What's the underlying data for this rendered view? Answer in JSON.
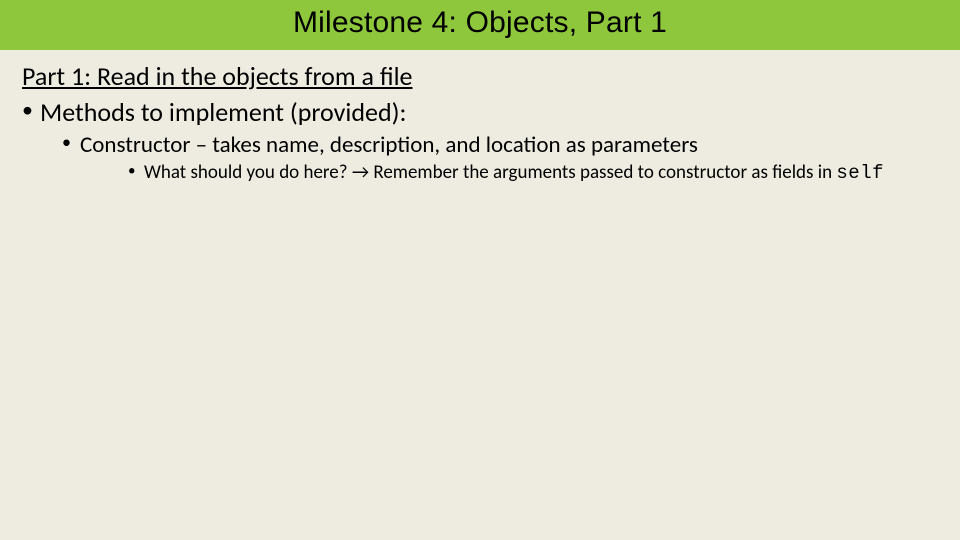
{
  "title": "Milestone 4: Objects, Part 1",
  "heading": "Part 1: Read in the objects from a file",
  "bullets": {
    "lvl1": "Methods to implement (provided):",
    "lvl2": "Constructor – takes name, description, and location as parameters",
    "lvl3_prefix": "What should you do here? → Remember the arguments passed to constructor as fields in ",
    "lvl3_code": "self"
  }
}
